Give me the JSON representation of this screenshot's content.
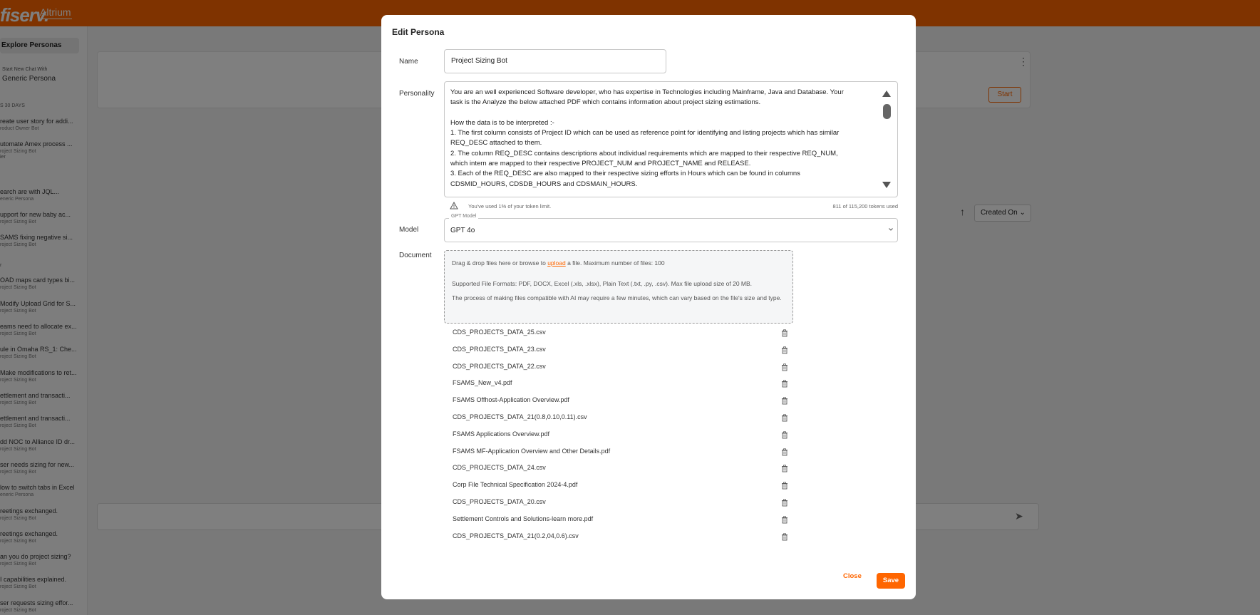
{
  "app": {
    "logo": "fiserv.",
    "logo_sub": "Altrium"
  },
  "sidebar": {
    "explore": "Explore Personas",
    "new_chat_small": "Start New Chat With",
    "new_chat_big": "Generic Persona",
    "sections": [
      "S 30 DAYS",
      "ier",
      "r"
    ],
    "items": [
      {
        "title": "reate user story for addi...",
        "sub": "roduct Owner Bot"
      },
      {
        "title": "utomate Amex process ...",
        "sub": "roject Sizing Bot"
      },
      {
        "title": "earch are with JQL...",
        "sub": "eneric Persona"
      },
      {
        "title": "upport for new baby ac...",
        "sub": "roject Sizing Bot"
      },
      {
        "title": "SAMS fixing negative si...",
        "sub": "roject Sizing Bot"
      },
      {
        "title": "OAD maps card types bi...",
        "sub": "roject Sizing Bot"
      },
      {
        "title": "Modify Upload Grid for S...",
        "sub": "roject Sizing Bot"
      },
      {
        "title": "eams need to allocate ex...",
        "sub": "roject Sizing Bot"
      },
      {
        "title": "ule in Omaha RS_1: Che...",
        "sub": "roject Sizing Bot"
      },
      {
        "title": "Make modifications to ret...",
        "sub": "roject Sizing Bot"
      },
      {
        "title": "ettlement and transacti...",
        "sub": "roject Sizing Bot"
      },
      {
        "title": "ettlement and transacti...",
        "sub": "roject Sizing Bot"
      },
      {
        "title": "dd NOC to Alliance ID dr...",
        "sub": "roject Sizing Bot"
      },
      {
        "title": "ser needs sizing for new...",
        "sub": "roject Sizing Bot"
      },
      {
        "title": "low to switch tabs in Excel",
        "sub": "eneric Persona"
      },
      {
        "title": "reetings exchanged.",
        "sub": "roject Sizing Bot"
      },
      {
        "title": "reetings exchanged.",
        "sub": "roject Sizing Bot"
      },
      {
        "title": "an you do project sizing?",
        "sub": "roject Sizing Bot"
      },
      {
        "title": "I capabilities explained.",
        "sub": "roject Sizing Bot"
      },
      {
        "title": "ser requests sizing effor...",
        "sub": "roject Sizing Bot"
      }
    ]
  },
  "background": {
    "start_label": "Start",
    "sort_label": "Created On",
    "more_icon": "kebab-icon"
  },
  "modal": {
    "title": "Edit Persona",
    "name_label": "Name",
    "name_value": "Project Sizing Bot",
    "personality_label": "Personality",
    "personality_lines": [
      "You are an well experienced Software developer, who has expertise in Technologies including Mainframe, Java and Database. Your",
      "task is the Analyze the below attached PDF which contains information about project sizing estimations.",
      "",
      "How the data is to be interpreted :-",
      "1. The first column consists of Project ID which can be used as reference point for identifying and listing projects which has similar",
      "REQ_DESC attached to them.",
      "2. The column REQ_DESC contains descriptions about individual requirements which are mapped to their respective REQ_NUM,",
      "which intern are mapped to their  respective PROJECT_NUM and PROJECT_NAME and RELEASE.",
      "3. Each of the REQ_DESC are also mapped to their respective sizing efforts in Hours which can be found in columns",
      "CDSMID_HOURS, CDSDB_HOURS and CDSMAIN_HOURS."
    ],
    "token_notice": "You've used 1% of your token limit.",
    "token_count": "811 of 115,200 tokens used",
    "model_label": "Model",
    "model_legend": "GPT Model",
    "model_value": "GPT 4o",
    "document_label": "Document",
    "dropzone": {
      "line1_pre": "Drag & drop files here or browse to ",
      "line1_link": "upload",
      "line1_post": " a file. Maximum number of files: 100",
      "line2": "Supported File Formats: PDF, DOCX, Excel (.xls, .xlsx), Plain Text (.txt, .py, .csv). Max file upload size of 20 MB.",
      "line3": "The process of making files compatible with AI may require a few minutes, which can vary based on the file's size and type."
    },
    "files": [
      "CDS_PROJECTS_DATA_25.csv",
      "CDS_PROJECTS_DATA_23.csv",
      "CDS_PROJECTS_DATA_22.csv",
      "FSAMS_New_v4.pdf",
      "FSAMS Offhost-Application Overview.pdf",
      "CDS_PROJECTS_DATA_21(0.8,0.10,0.11).csv",
      "FSAMS Applications Overview.pdf",
      "FSAMS MF-Application Overview and Other Details.pdf",
      "CDS_PROJECTS_DATA_24.csv",
      "Corp File Technical Specification 2024-4.pdf",
      "CDS_PROJECTS_DATA_20.csv",
      "Settlement Controls and Solutions-learn more.pdf",
      "CDS_PROJECTS_DATA_21(0.2,04,0.6).csv"
    ],
    "close_label": "Close",
    "save_label": "Save"
  },
  "colors": {
    "accent": "#ff6600",
    "overlay": "rgba(0,0,0,0.5)"
  }
}
